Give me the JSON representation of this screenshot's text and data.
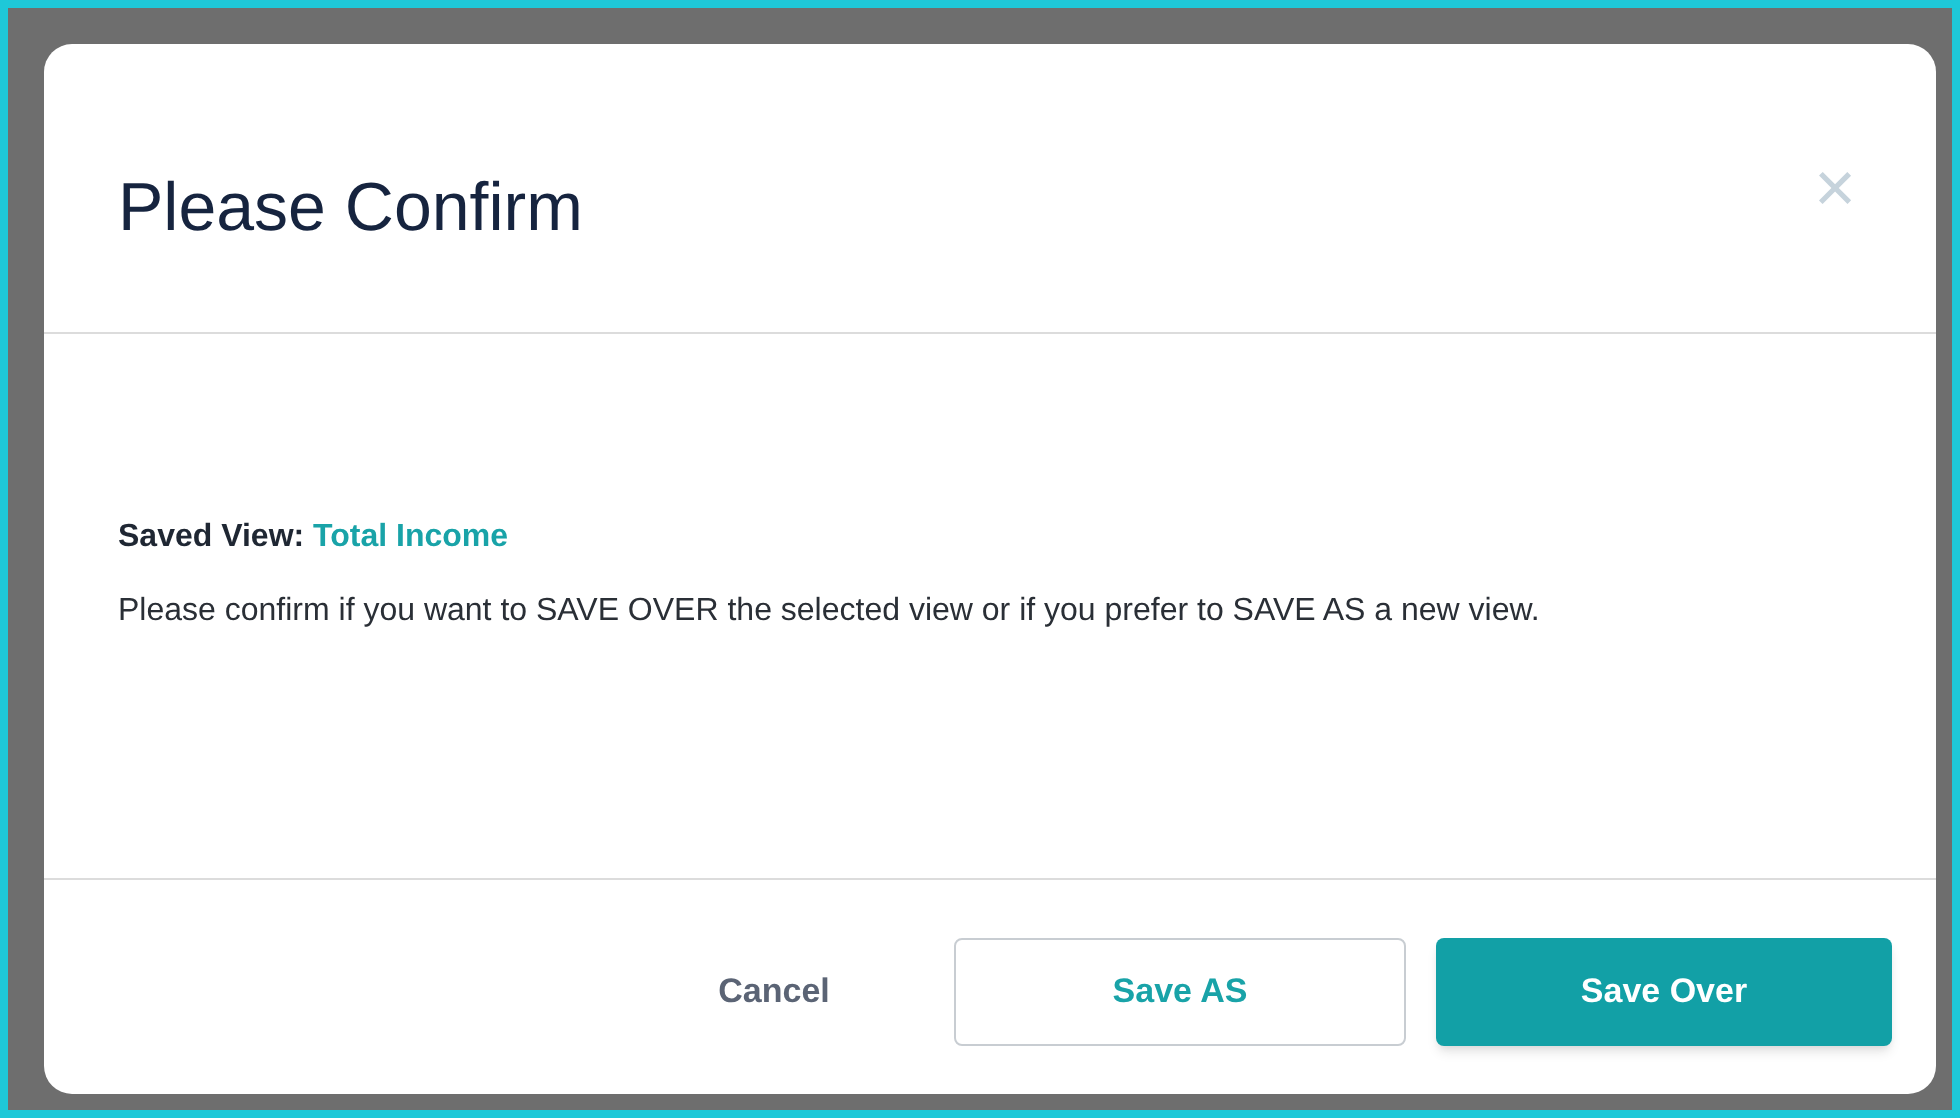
{
  "dialog": {
    "title": "Please Confirm",
    "close": "×",
    "saved_view": {
      "label": "Saved View:",
      "value": "Total Income"
    },
    "message": "Please confirm if you want to SAVE OVER the selected view or if you prefer to SAVE AS a new view.",
    "buttons": [
      {
        "label": "Cancel",
        "kind": "link"
      },
      {
        "label": "Save AS",
        "kind": "outline"
      },
      {
        "label": "Save Over",
        "kind": "primary"
      }
    ]
  }
}
